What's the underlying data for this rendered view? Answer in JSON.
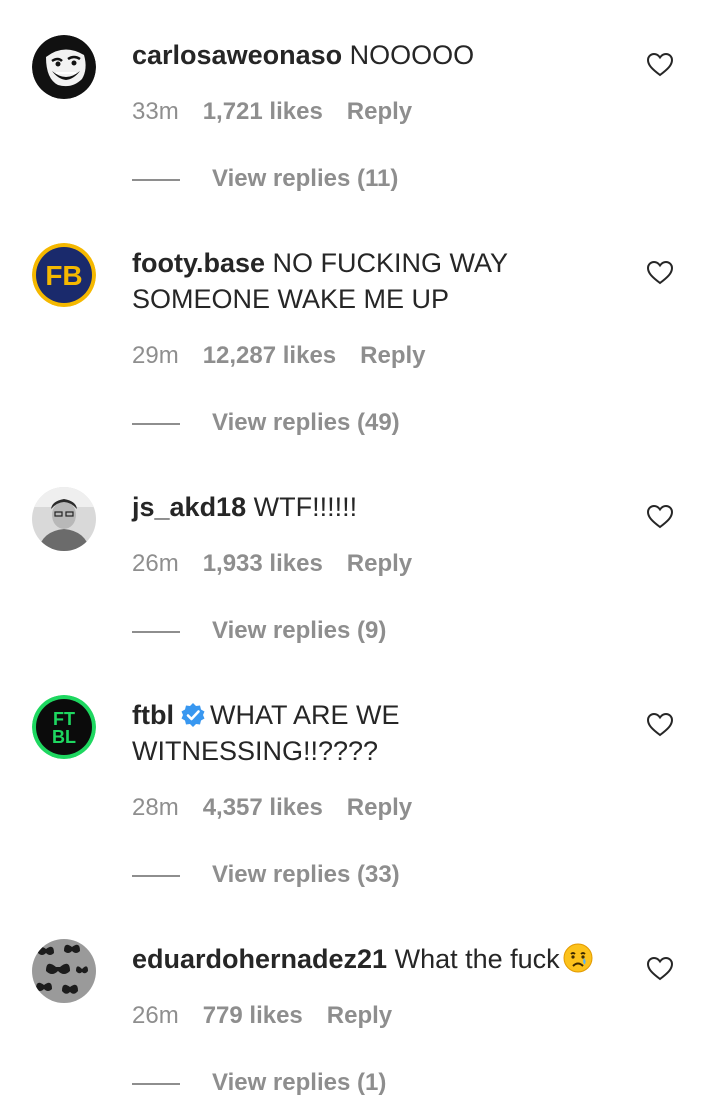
{
  "comments": [
    {
      "username": "carlosaweonaso",
      "text": "NOOOOO",
      "time": "33m",
      "likes": "1,721 likes",
      "reply_label": "Reply",
      "view_replies": "View replies (11)",
      "avatar": "troll-face-avatar"
    },
    {
      "username": "footy.base",
      "text": "NO FUCKING WAY SOMEONE WAKE ME UP",
      "time": "29m",
      "likes": "12,287 likes",
      "reply_label": "Reply",
      "view_replies": "View replies (49)",
      "avatar": "fb-logo-avatar",
      "avatar_text": "FB"
    },
    {
      "username": "js_akd18",
      "text": "WTF!!!!!!",
      "time": "26m",
      "likes": "1,933 likes",
      "reply_label": "Reply",
      "view_replies": "View replies (9)",
      "avatar": "photo-avatar"
    },
    {
      "username": "ftbl",
      "verified": true,
      "text": "WHAT ARE WE WITNESSING!!????",
      "time": "28m",
      "likes": "4,357 likes",
      "reply_label": "Reply",
      "view_replies": "View replies (33)",
      "avatar": "ftbl-logo-avatar",
      "avatar_text_top": "FT",
      "avatar_text_bottom": "BL"
    },
    {
      "username": "eduardohernadez21",
      "text": "What the fuck",
      "emoji": "crying-face-emoji",
      "time": "26m",
      "likes": "779 likes",
      "reply_label": "Reply",
      "view_replies": "View replies (1)",
      "avatar": "butterflies-avatar"
    }
  ],
  "icons": {
    "like": "heart-outline-icon",
    "verified": "verified-badge-icon"
  },
  "colors": {
    "text": "#262626",
    "secondary": "#8e8e8e",
    "verified": "#3897f0",
    "ftbl_green": "#1ed760",
    "fb_yellow": "#f5b800"
  }
}
